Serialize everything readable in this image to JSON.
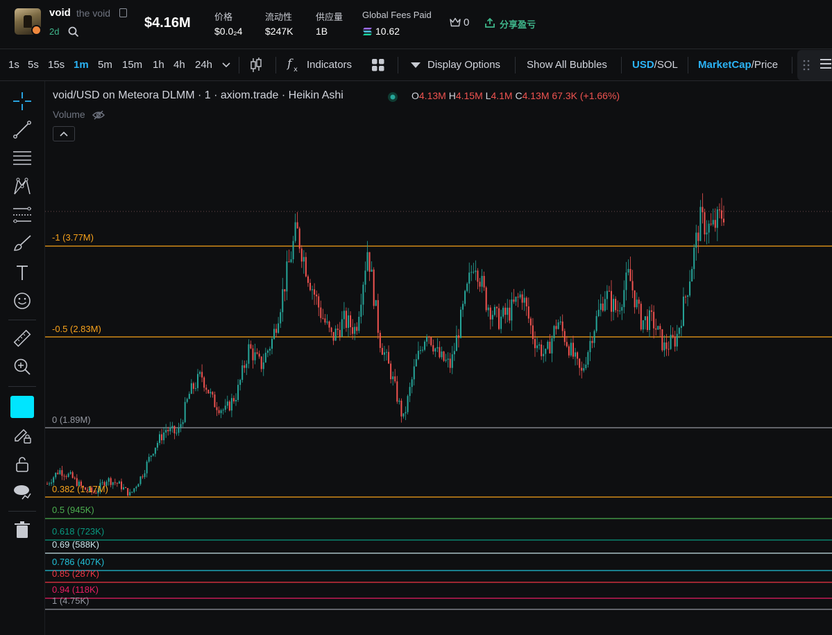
{
  "token": {
    "symbol": "void",
    "name": "the void",
    "age": "2d",
    "market_cap": "$4.16M"
  },
  "stats": [
    {
      "label": "价格",
      "value": "$0.0₂4"
    },
    {
      "label": "流动性",
      "value": "$247K"
    },
    {
      "label": "供应量",
      "value": "1B"
    },
    {
      "label": "Global Fees Paid",
      "value": "10.62"
    }
  ],
  "holders_count": "0",
  "share_label": "分享盈亏",
  "timeframes": [
    "1s",
    "5s",
    "15s",
    "1m",
    "5m",
    "15m",
    "1h",
    "4h",
    "24h"
  ],
  "active_timeframe": "1m",
  "toolbar": {
    "indicators": "Indicators",
    "display_options": "Display Options",
    "show_bubbles": "Show All Bubbles",
    "usd": "USD",
    "sol": "/SOL",
    "marketcap": "MarketCap",
    "price": "/Price"
  },
  "chart": {
    "legend": "void/USD on Meteora DLMM · 1 · axiom.trade · Heikin Ashi",
    "ohlc": {
      "o": "4.13M",
      "h": "4.15M",
      "l": "4.1M",
      "c": "4.13M",
      "change": "67.3K (+1.66%)"
    },
    "volume_label": "Volume"
  },
  "fib_levels": [
    {
      "label": "-1 (3.77M)",
      "color": "#f7a21b"
    },
    {
      "label": "-0.5 (2.83M)",
      "color": "#f7a21b"
    },
    {
      "label": "0 (1.89M)",
      "color": "#9598a1"
    },
    {
      "label": "0.382 (1.17M)",
      "color": "#f7a21b"
    },
    {
      "label": "0.5 (945K)",
      "color": "#4caf50"
    },
    {
      "label": "0.618 (723K)",
      "color": "#089981"
    },
    {
      "label": "0.69 (588K)",
      "color": "#c9e4ea"
    },
    {
      "label": "0.786 (407K)",
      "color": "#22c0d8"
    },
    {
      "label": "0.85 (287K)",
      "color": "#f23645"
    },
    {
      "label": "0.94 (118K)",
      "color": "#e91e63"
    },
    {
      "label": "1 (4.75K)",
      "color": "#9598a1"
    }
  ],
  "chart_data": {
    "type": "line",
    "title": "void/USD on Meteora DLMM · 1 · axiom.trade · Heikin Ashi",
    "y_unit": "USD market cap",
    "ylim": [
      0,
      4200000
    ],
    "series": [
      {
        "name": "",
        "values": [
          1100000,
          1250000,
          1180000,
          1050000,
          1000000,
          1150000,
          1100000,
          980000,
          1200000,
          1500000,
          1700000,
          1650000,
          2100000,
          2300000,
          2000000,
          1900000,
          2100000,
          2600000,
          2400000,
          2700000,
          3300000,
          3900000,
          3400000,
          3000000,
          2700000,
          2900000,
          2800000,
          3700000,
          2700000,
          2300000,
          1800000,
          2400000,
          2800000,
          2500000,
          2400000,
          3000000,
          3600000,
          3100000,
          2900000,
          3000000,
          3200000,
          2700000,
          2500000,
          2900000,
          2600000,
          2300000,
          2800000,
          3200000,
          3000000,
          3400000,
          2900000,
          2900000,
          2600000,
          2700000,
          3300000,
          4000000,
          3900000,
          4100000
        ]
      }
    ],
    "colors": {
      "up": "#26a69a",
      "down": "#ef5350"
    }
  },
  "colors": {
    "accent": "#2bb3f5",
    "green": "#3fb68b",
    "drawing_color": "#00e5ff"
  }
}
